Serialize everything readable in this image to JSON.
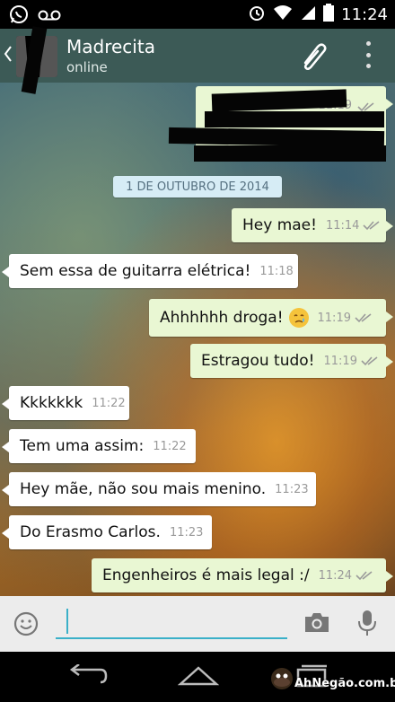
{
  "status_bar": {
    "time": "11:24",
    "left_icons": [
      "whatsapp-icon",
      "voicemail-icon"
    ],
    "right_icons": [
      "alarm-icon",
      "wifi-icon",
      "signal-icon",
      "battery-icon"
    ]
  },
  "header": {
    "contact_name": "Madrecita",
    "status": "online",
    "icons": [
      "back-icon",
      "paperclip-icon",
      "overflow-menu-icon"
    ]
  },
  "date_chip": "1 DE OUTUBRO DE 2014",
  "messages": [
    {
      "direction": "out",
      "text": "Hey mae!",
      "time": "11:14",
      "ticks": "double"
    },
    {
      "direction": "in",
      "text": "Sem essa de guitarra elétrica!",
      "time": "11:18"
    },
    {
      "direction": "out",
      "text": "Ahhhhhh droga!",
      "emoji": "crying-face-emoji",
      "time": "11:19",
      "ticks": "double"
    },
    {
      "direction": "out",
      "text": "Estragou tudo!",
      "time": "11:19",
      "ticks": "double"
    },
    {
      "direction": "in",
      "text": "Kkkkkkk",
      "time": "11:22"
    },
    {
      "direction": "in",
      "text": "Tem uma assim:",
      "time": "11:22"
    },
    {
      "direction": "in",
      "text": "Hey mãe, não sou mais menino.",
      "time": "11:23"
    },
    {
      "direction": "in",
      "text": "Do Erasmo Carlos.",
      "time": "11:23"
    },
    {
      "direction": "out",
      "text": "Engenheiros é mais legal :/",
      "time": "11:24",
      "ticks": "double"
    }
  ],
  "redacted_message_time": "11:19",
  "input_bar": {
    "icons": [
      "smiley-icon",
      "camera-icon",
      "microphone-icon"
    ]
  },
  "nav_bar": {
    "icons": [
      "back-nav-icon",
      "home-nav-icon",
      "recents-nav-icon"
    ]
  },
  "watermark": {
    "text": "AhNegão.com.br"
  },
  "colors": {
    "header_bg": "#3c5a56",
    "outgoing_bubble": "#e9f7d3",
    "incoming_bubble": "#ffffff",
    "date_chip_bg": "#d6ecf5",
    "tick_color": "#9a9a9a",
    "input_accent": "#3ab0c8"
  }
}
